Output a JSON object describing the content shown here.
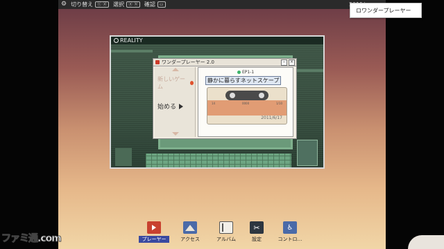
{
  "toolbar": {
    "items": [
      {
        "label": "切り替え",
        "key": "ⓒ ⓓ"
      },
      {
        "label": "選択",
        "key": "ⓐ ⓑ"
      },
      {
        "label": "確認",
        "key": "▭"
      }
    ],
    "date_partial": "2011/"
  },
  "popup": {
    "label": "ロワンダープレーヤー"
  },
  "reality": {
    "title": "REALITY"
  },
  "wonder_player": {
    "title": "ワンダープレーヤー 2.0",
    "menu_new": "新しいゲーム",
    "menu_start": "始める",
    "episode": "EP1-1",
    "song_title": "静かに暮らすネットスケープ",
    "date": "2011/6/17",
    "tape_nums": [
      "14",
      "0000",
      "1/10"
    ]
  },
  "nav": [
    {
      "label": "プレーヤー",
      "icon": "player-icon",
      "color": "#c8412f"
    },
    {
      "label": "アクセス",
      "icon": "access-icon",
      "color": "#4a6aa8"
    },
    {
      "label": "アルバム",
      "icon": "album-icon",
      "color": "#f2efe8"
    },
    {
      "label": "設定",
      "icon": "settings-icon",
      "color": "#2d3640"
    },
    {
      "label": "コントロ…",
      "icon": "control-icon",
      "color": "#4a6aa8"
    }
  ],
  "watermark": "ファミ通.com"
}
